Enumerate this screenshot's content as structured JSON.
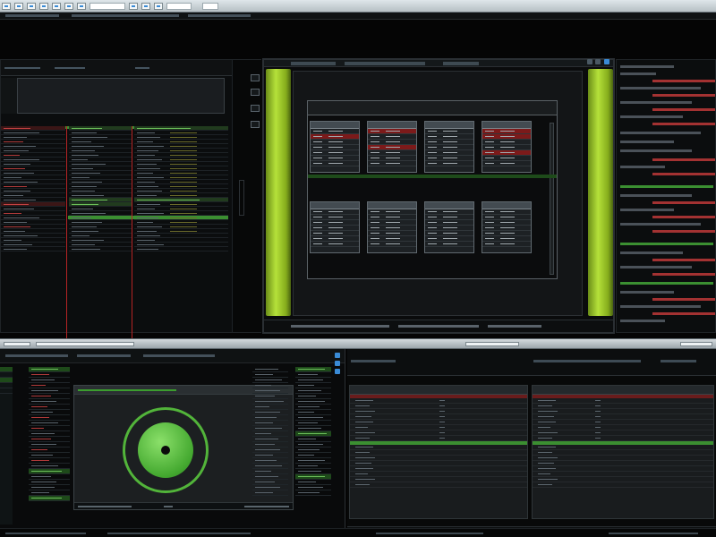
{
  "app": {
    "accent_green": "#b5e13a",
    "accent_blue": "#3a8bd6",
    "alert_red": "#b03a3a",
    "background": "#050505"
  },
  "toolbar": {
    "icons": [
      "app-icon",
      "file-icon",
      "edit-icon",
      "view-icon",
      "tools-icon",
      "window-icon",
      "help-icon",
      "layout-icon",
      "panel-icon",
      "grid-icon",
      "search-icon",
      "settings-icon"
    ]
  },
  "panels": {
    "upper_left": {
      "name": "data-grid-panel"
    },
    "upper_center": {
      "name": "workspace-panel"
    },
    "upper_right": {
      "name": "inspector-panel"
    },
    "lower_left": {
      "name": "radar-viewer-panel"
    },
    "lower_right": {
      "name": "table-viewer-panel"
    }
  },
  "center": {
    "mini_tables": 8
  },
  "lower_left": {
    "target": {
      "shape": "circle",
      "color": "#52b43a"
    }
  }
}
